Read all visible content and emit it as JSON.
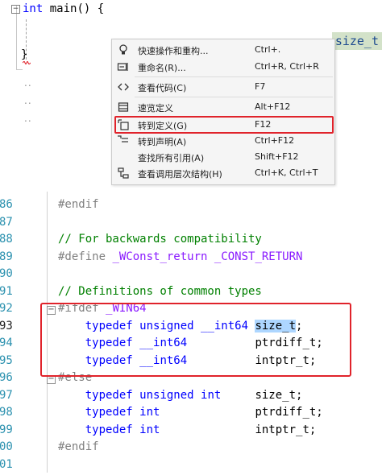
{
  "top_editor": {
    "code_line": {
      "keyword": "int",
      "text": " main() {"
    },
    "close_brace": "}",
    "right_token": "size_t",
    "dots": [
      "..",
      "..",
      ".."
    ]
  },
  "context_menu": {
    "items": [
      {
        "icon": "lightbulb-icon",
        "label": "快速操作和重构...",
        "shortcut": "Ctrl+."
      },
      {
        "icon": "rename-icon",
        "label": "重命名(R)...",
        "shortcut": "Ctrl+R, Ctrl+R"
      },
      {
        "icon": "code-icon",
        "label": "查看代码(C)",
        "shortcut": "F7"
      },
      {
        "icon": "peek-definition-icon",
        "label": "速览定义",
        "shortcut": "Alt+F12"
      },
      {
        "icon": "goto-definition-icon",
        "label": "转到定义(G)",
        "shortcut": "F12"
      },
      {
        "icon": "goto-declaration-icon",
        "label": "转到声明(A)",
        "shortcut": "Ctrl+F12"
      },
      {
        "icon": "",
        "label": "查找所有引用(A)",
        "shortcut": "Shift+F12"
      },
      {
        "icon": "call-hierarchy-icon",
        "label": "查看调用层次结构(H)",
        "shortcut": "Ctrl+K, Ctrl+T"
      }
    ],
    "highlighted_item": "转到定义(G)"
  },
  "bottom_editor": {
    "lines": [
      {
        "num": "86",
        "code": [
          {
            "t": "#endif",
            "c": "pp"
          }
        ]
      },
      {
        "num": "87",
        "code": []
      },
      {
        "num": "88",
        "code": [
          {
            "t": "// For backwards compatibility",
            "c": "cm"
          }
        ]
      },
      {
        "num": "89",
        "code": [
          {
            "t": "#define ",
            "c": "pp"
          },
          {
            "t": "_WConst_return _CONST_RETURN",
            "c": "macro"
          }
        ]
      },
      {
        "num": "90",
        "code": []
      },
      {
        "num": "91",
        "code": [
          {
            "t": "// Definitions of common types",
            "c": "cm"
          }
        ]
      },
      {
        "num": "92",
        "collapse": "−",
        "code": [
          {
            "t": "#ifdef ",
            "c": "pp"
          },
          {
            "t": "_WIN64",
            "c": "macro"
          }
        ]
      },
      {
        "num": "93",
        "active": true,
        "code": [
          {
            "t": "    typedef ",
            "c": "kwb"
          },
          {
            "t": "unsigned ",
            "c": "kwb"
          },
          {
            "t": "__int64 ",
            "c": "kwb"
          },
          {
            "t": "size_t",
            "c": "id sel"
          },
          {
            "t": ";",
            "c": "id"
          }
        ]
      },
      {
        "num": "94",
        "code": [
          {
            "t": "    typedef ",
            "c": "kwb"
          },
          {
            "t": "__int64          ",
            "c": "kwb"
          },
          {
            "t": "ptrdiff_t;",
            "c": "id"
          }
        ]
      },
      {
        "num": "95",
        "code": [
          {
            "t": "    typedef ",
            "c": "kwb"
          },
          {
            "t": "__int64          ",
            "c": "kwb"
          },
          {
            "t": "intptr_t;",
            "c": "id"
          }
        ]
      },
      {
        "num": "96",
        "collapse": "−",
        "code": [
          {
            "t": "#else",
            "c": "pp"
          }
        ]
      },
      {
        "num": "97",
        "code": [
          {
            "t": "    typedef ",
            "c": "kwb"
          },
          {
            "t": "unsigned int     ",
            "c": "kwb"
          },
          {
            "t": "size_t;",
            "c": "id"
          }
        ]
      },
      {
        "num": "98",
        "code": [
          {
            "t": "    typedef ",
            "c": "kwb"
          },
          {
            "t": "int              ",
            "c": "kwb"
          },
          {
            "t": "ptrdiff_t;",
            "c": "id"
          }
        ]
      },
      {
        "num": "99",
        "code": [
          {
            "t": "    typedef ",
            "c": "kwb"
          },
          {
            "t": "int              ",
            "c": "kwb"
          },
          {
            "t": "intptr_t;",
            "c": "id"
          }
        ]
      },
      {
        "num": "00",
        "code": [
          {
            "t": "#endif",
            "c": "pp"
          }
        ]
      },
      {
        "num": "01",
        "code": []
      }
    ]
  },
  "colors": {
    "highlight_border": "#e0232b",
    "keyword": "#0000ff",
    "comment": "#008000",
    "macro": "#8a1bff",
    "preprocessor": "#808080",
    "line_number": "#2b91af"
  }
}
